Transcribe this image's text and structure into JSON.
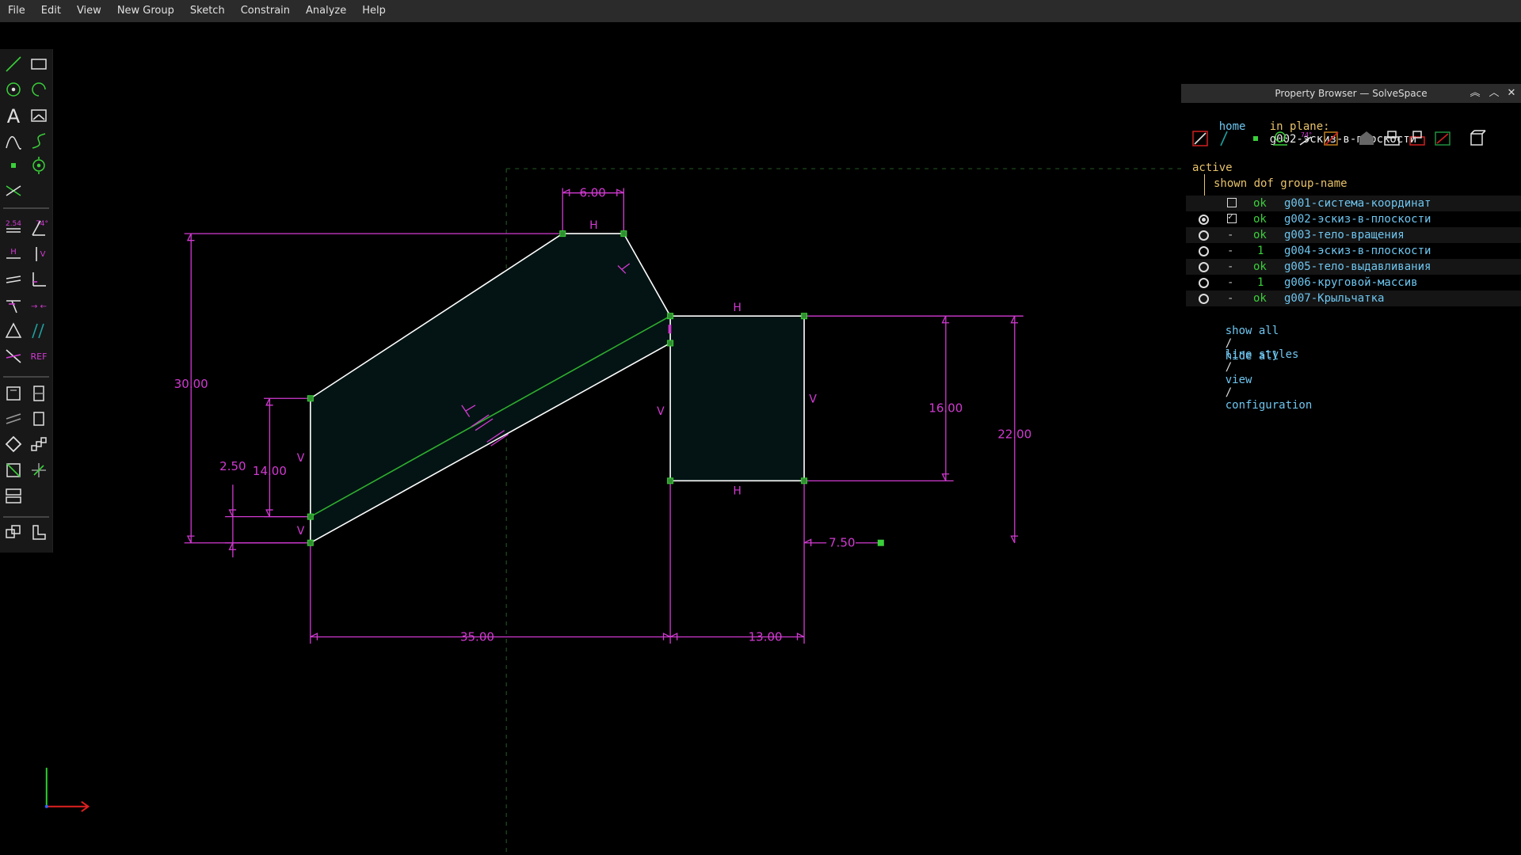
{
  "menu": [
    "File",
    "Edit",
    "View",
    "New Group",
    "Sketch",
    "Constrain",
    "Analyze",
    "Help"
  ],
  "toolbar": {
    "icons": [
      "line-tool-icon",
      "rectangle-tool-icon",
      "circle-tool-icon",
      "arc-tool-icon",
      "text-tool-icon",
      "image-tool-icon",
      "tangent-arc-icon",
      "bezier-icon",
      "point-tool-icon",
      "workplane-icon",
      "split-curves-icon",
      "distance-constraint-icon",
      "angle-constraint-icon",
      "horizontal-constraint-icon",
      "vertical-constraint-icon",
      "parallel-constraint-icon",
      "perpendicular-constraint-icon",
      "point-on-line-icon",
      "symmetric-icon",
      "equal-constraint-icon",
      "same-orientation-icon",
      "other-supplementary-icon",
      "reference-icon",
      "extrude-icon",
      "lathe-icon",
      "revolve-icon",
      "helix-icon",
      "rotate-group-icon",
      "translate-group-icon",
      "workplane-group-icon",
      "nearest-ortho-icon",
      "link-icon",
      "isometric-view-icon",
      "step-export-icon"
    ],
    "labels": {
      "distance": "2.54",
      "angle": "74°",
      "h": "H",
      "v": "V",
      "ref": "REF"
    }
  },
  "sketch": {
    "dimensions": [
      "6.00",
      "30.00",
      "14.00",
      "2.50",
      "16.00",
      "22.00",
      "7.50",
      "35.00",
      "13.00"
    ],
    "constraint_labels": [
      "H",
      "H",
      "H",
      "V",
      "V",
      "V",
      "V",
      "V"
    ],
    "colors": {
      "constraint": "#d23ad2",
      "line": "#ffffff",
      "construction": "#2fae2f",
      "point": "#3ad03a",
      "fill": "#041414",
      "dashed": "#1f4f1f"
    }
  },
  "property_browser": {
    "title": "Property Browser — SolveSpace",
    "home_link": "home",
    "plane_label": "in plane:",
    "plane_value": "g002-эскиз-в-плоскости",
    "toolbar_icons": [
      "delete-constraint-icon",
      "arrow-icon",
      "point-icon",
      "workplane-icon",
      "angle-icon",
      "sketch-icon",
      "step-icon",
      "solid-icon",
      "mesh-icon",
      "cut-icon",
      "box-icon"
    ],
    "header_active": "active",
    "header_cols": "shown dof group-name",
    "groups": [
      {
        "active": false,
        "show_radio": false,
        "shown": false,
        "dof": "ok",
        "name": "g001-система-координат"
      },
      {
        "active": true,
        "show_radio": true,
        "shown": true,
        "dof": "ok",
        "name": "g002-эскиз-в-плоскости"
      },
      {
        "active": false,
        "show_radio": true,
        "shown": "-",
        "dof": "ok",
        "name": "g003-тело-вращения"
      },
      {
        "active": false,
        "show_radio": true,
        "shown": "-",
        "dof": "1",
        "name": "g004-эскиз-в-плоскости"
      },
      {
        "active": false,
        "show_radio": true,
        "shown": "-",
        "dof": "ok",
        "name": "g005-тело-выдавливания"
      },
      {
        "active": false,
        "show_radio": true,
        "shown": "-",
        "dof": "1",
        "name": "g006-круговой-массив"
      },
      {
        "active": false,
        "show_radio": true,
        "shown": "-",
        "dof": "ok",
        "name": "g007-Крыльчатка"
      }
    ],
    "show_all": "show all",
    "hide_all": "hide all",
    "sep": "/",
    "line_styles": "line styles",
    "view": "view",
    "configuration": "configuration"
  }
}
